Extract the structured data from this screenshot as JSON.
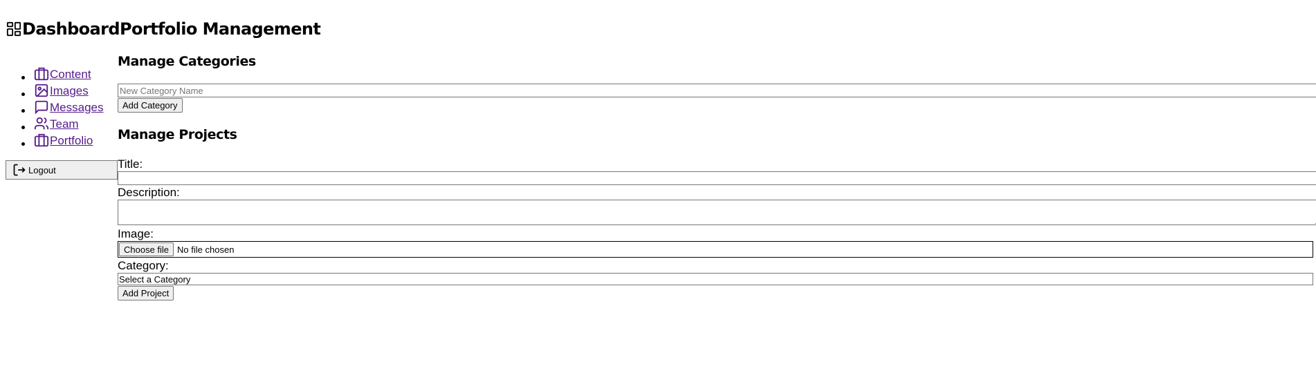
{
  "header": {
    "title": "DashboardPortfolio Management",
    "icon": "dashboard-grid-icon"
  },
  "sidebar": {
    "items": [
      {
        "label": "Content",
        "icon": "briefcase-icon"
      },
      {
        "label": "Images",
        "icon": "image-icon"
      },
      {
        "label": "Messages",
        "icon": "message-icon"
      },
      {
        "label": "Team",
        "icon": "users-icon"
      },
      {
        "label": "Portfolio",
        "icon": "briefcase-icon"
      }
    ],
    "logout_label": "Logout"
  },
  "categories": {
    "heading": "Manage Categories",
    "input_placeholder": "New Category Name",
    "add_button": "Add Category"
  },
  "projects": {
    "heading": "Manage Projects",
    "title_label": "Title:",
    "description_label": "Description:",
    "image_label": "Image:",
    "choose_file": "Choose file",
    "no_file": "No file chosen",
    "category_label": "Category:",
    "category_selected": "Select a Category",
    "add_button": "Add Project"
  },
  "colors": {
    "link": "#551a8b",
    "button_bg": "#efefef",
    "border": "#767676"
  }
}
